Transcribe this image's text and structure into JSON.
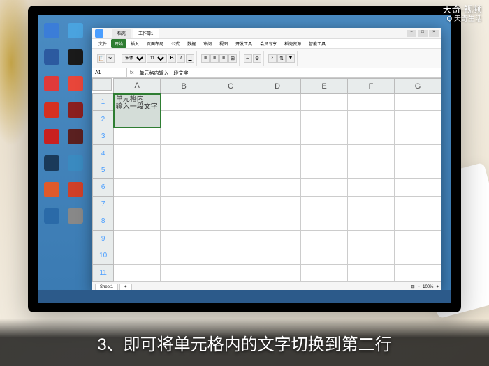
{
  "watermark": {
    "line1": "天奇·视频",
    "line2": "Q 天奇生活"
  },
  "caption": "3、即可将单元格内的文字切换到第二行",
  "window": {
    "tabs": [
      {
        "label": "稻壳"
      },
      {
        "label": "工作簿1"
      }
    ],
    "menus": [
      "文件",
      "开始",
      "插入",
      "页面布局",
      "公式",
      "数据",
      "审阅",
      "视图",
      "开发工具",
      "会员专享",
      "稻壳资源",
      "智能工具"
    ],
    "active_menu": "开始",
    "font": "宋体",
    "fontsize": "11",
    "cellref": "A1",
    "formula": "单元格内输入一段文字"
  },
  "sheet": {
    "cols": [
      "A",
      "B",
      "C",
      "D",
      "E",
      "F",
      "G"
    ],
    "rows": [
      1,
      2,
      3,
      4,
      5,
      6,
      7,
      8,
      9,
      10,
      11
    ],
    "a1": "单元格内输入一段文字",
    "sheet_name": "Sheet1",
    "zoom": "100%"
  },
  "desktop_icons": [
    {
      "c": "#3b7dd8"
    },
    {
      "c": "#4aa3df"
    },
    {
      "c": "#2c5aa0"
    },
    {
      "c": "#1a1a1a"
    },
    {
      "c": "#e03a3a"
    },
    {
      "c": "#e8463a"
    },
    {
      "c": "#d63020"
    },
    {
      "c": "#8a1f1f"
    },
    {
      "c": "#c92020"
    },
    {
      "c": "#5a2020"
    },
    {
      "c": "#1a3a5a"
    },
    {
      "c": "#3a8ac0"
    },
    {
      "c": "#e05a2a"
    },
    {
      "c": "#d04028"
    },
    {
      "c": "#2a6aa8"
    },
    {
      "c": "#888"
    }
  ]
}
